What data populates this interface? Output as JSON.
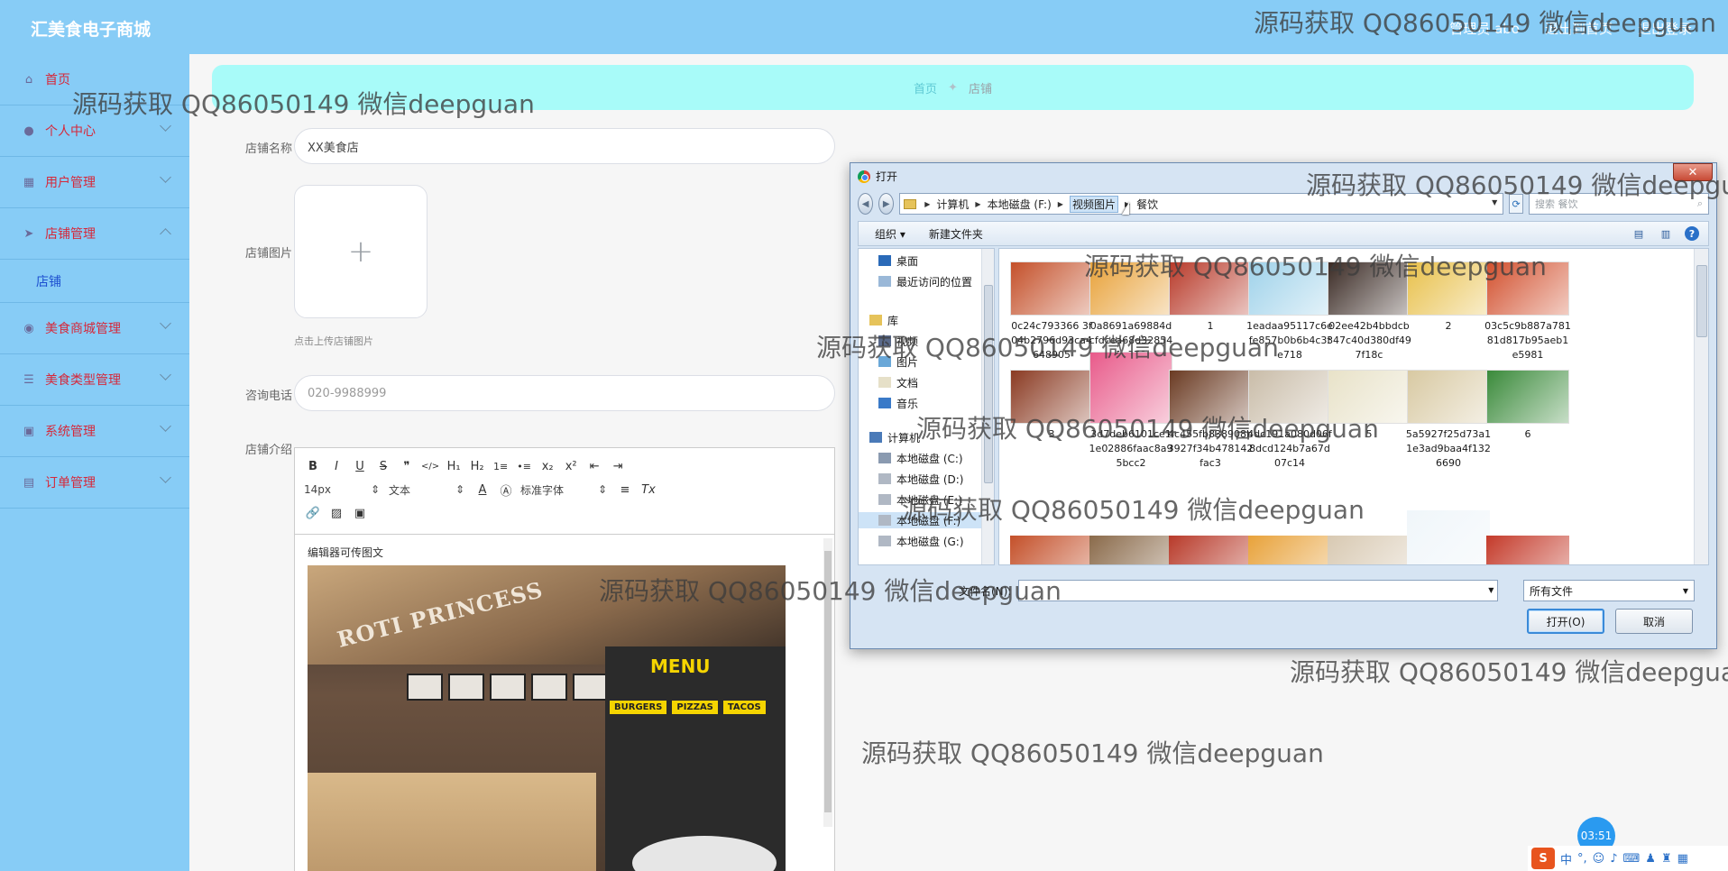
{
  "app": {
    "title": "汇美食电子商城"
  },
  "header": {
    "links": [
      "管理员 abo",
      "退出到首页",
      "退出登录"
    ]
  },
  "sidebar": {
    "items": [
      {
        "label": "首页",
        "icon": "home-icon"
      },
      {
        "label": "个人中心",
        "icon": "user-icon"
      },
      {
        "label": "用户管理",
        "icon": "chart-icon"
      },
      {
        "label": "店铺管理",
        "icon": "send-icon"
      },
      {
        "label": "店铺",
        "icon": ""
      },
      {
        "label": "美食商城管理",
        "icon": "palette-icon"
      },
      {
        "label": "美食类型管理",
        "icon": "list-icon"
      },
      {
        "label": "系统管理",
        "icon": "gear-icon"
      },
      {
        "label": "订单管理",
        "icon": "cart-icon"
      }
    ]
  },
  "breadcrumb": {
    "home": "首页",
    "current": "店铺"
  },
  "form": {
    "name_label": "店铺名称",
    "name_value": "XX美食店",
    "image_label": "店铺图片",
    "upload_tip": "点击上传店铺图片",
    "phone_label": "咨询电话",
    "phone_placeholder": "020-9988999",
    "intro_label": "店铺介绍"
  },
  "editor": {
    "toolbar_row1": [
      "B",
      "I",
      "U",
      "S",
      "❞",
      "</>",
      "H₁",
      "H₂",
      "1≡",
      "•≡",
      "x₂",
      "x²",
      "⇤",
      "⇥"
    ],
    "font_size": "14px",
    "block": "文本",
    "font_family": "标准字体",
    "body_text": "编辑器可传图文",
    "photo_sign": "ROTI PRINCESS",
    "photo_menu": "MENU",
    "photo_tags": [
      "BURGERS",
      "PIZZAS",
      "TACOS"
    ]
  },
  "dialog": {
    "title": "打开",
    "address": [
      "计算机",
      "本地磁盘 (F:)",
      "视频图片",
      "餐饮"
    ],
    "search_placeholder": "搜索 餐饮",
    "organize": "组织 ▾",
    "new_folder": "新建文件夹",
    "tree": [
      "桌面",
      "最近访问的位置",
      "库",
      "视频",
      "图片",
      "文档",
      "音乐",
      "计算机",
      "本地磁盘 (C:)",
      "本地磁盘 (D:)",
      "本地磁盘 (E:)",
      "本地磁盘 (F:)",
      "本地磁盘 (G:)"
    ],
    "files": [
      {
        "name": "0c24c793366 3f04b2796d93ca4648905",
        "color": "#c4502a"
      },
      {
        "name": "0a8691a69884dcfdcea68d328541c970",
        "color": "#e8a23a"
      },
      {
        "name": "1",
        "color": "#b83a2a"
      },
      {
        "name": "1eadaa95117c6efe857b0b6b4c3fe718",
        "color": "#9fd2ea"
      },
      {
        "name": "02ee42b4bbdcb347c40d380df497f18c",
        "color": "#3a2a24"
      },
      {
        "name": "2",
        "color": "#e8c04a"
      },
      {
        "name": "03c5c9b887a78181d817b95aeb1e5981",
        "color": "#d2502e"
      },
      {
        "name": "3",
        "color": "#8a3a22"
      },
      {
        "name": "3d7deb6101ce11e02886faac8a95bcc2",
        "color": "#e85a8a"
      },
      {
        "name": "4c455fb838908b3927f34b478142fac3",
        "color": "#6a3a22"
      },
      {
        "name": "4dc191a080d06f8dcd124b7a67d07c14",
        "color": "#c9bca8"
      },
      {
        "name": "5",
        "color": "#e8e2c8"
      },
      {
        "name": "5a5927f25d73a11e3ad9baa4f1326690",
        "color": "#d8c9a2"
      },
      {
        "name": "6",
        "color": "#3a8a3a"
      }
    ],
    "filename_label": "文件名(N):",
    "filetype": "所有文件",
    "open_button": "打开(O)",
    "cancel_button": "取消"
  },
  "watermark": "源码获取 QQ86050149 微信deepguan",
  "timer": "03:51",
  "ime": {
    "logo": "S",
    "lang": "中"
  }
}
